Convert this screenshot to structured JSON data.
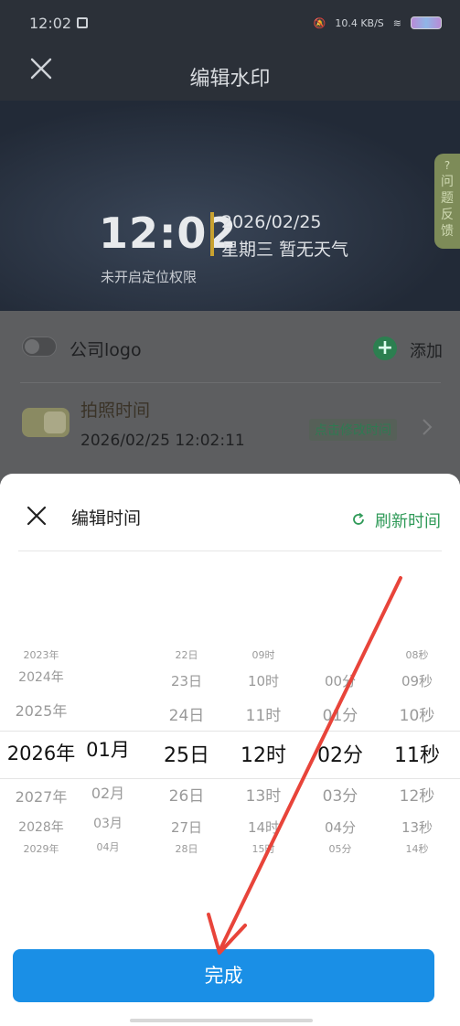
{
  "status_bar": {
    "time": "12:02",
    "net": "10.4 KB/S"
  },
  "header": {
    "title": "编辑水印"
  },
  "watermark": {
    "time": "12:02",
    "date": "2026/02/25",
    "weekday_weather": "星期三  暂无天气",
    "location": "未开启定位权限",
    "feedback": "问\n题\n反\n馈"
  },
  "settings": {
    "logo_label": "公司logo",
    "add_label": "添加",
    "photo_time_label": "拍照时间",
    "photo_time_value": "2026/02/25 12:02:11",
    "modify_label": "点击修改时间"
  },
  "sheet": {
    "title": "编辑时间",
    "refresh_label": "刷新时间",
    "done_label": "完成"
  },
  "picker": {
    "years": [
      "2023年",
      "2024年",
      "2025年",
      "2026年",
      "2027年",
      "2028年",
      "2029年"
    ],
    "months": [
      "01月",
      "02月",
      "03月",
      "04月"
    ],
    "days": [
      "22日",
      "23日",
      "24日",
      "25日",
      "26日",
      "27日",
      "28日"
    ],
    "hours": [
      "09时",
      "10时",
      "11时",
      "12时",
      "13时",
      "14时",
      "15时"
    ],
    "minutes": [
      "00分",
      "01分",
      "02分",
      "03分",
      "04分",
      "05分"
    ],
    "seconds": [
      "08秒",
      "09秒",
      "10秒",
      "11秒",
      "12秒",
      "13秒",
      "14秒"
    ],
    "selected": {
      "year": "2026年",
      "month": "01月",
      "day": "25日",
      "hour": "12时",
      "minute": "02分",
      "second": "11秒"
    }
  }
}
